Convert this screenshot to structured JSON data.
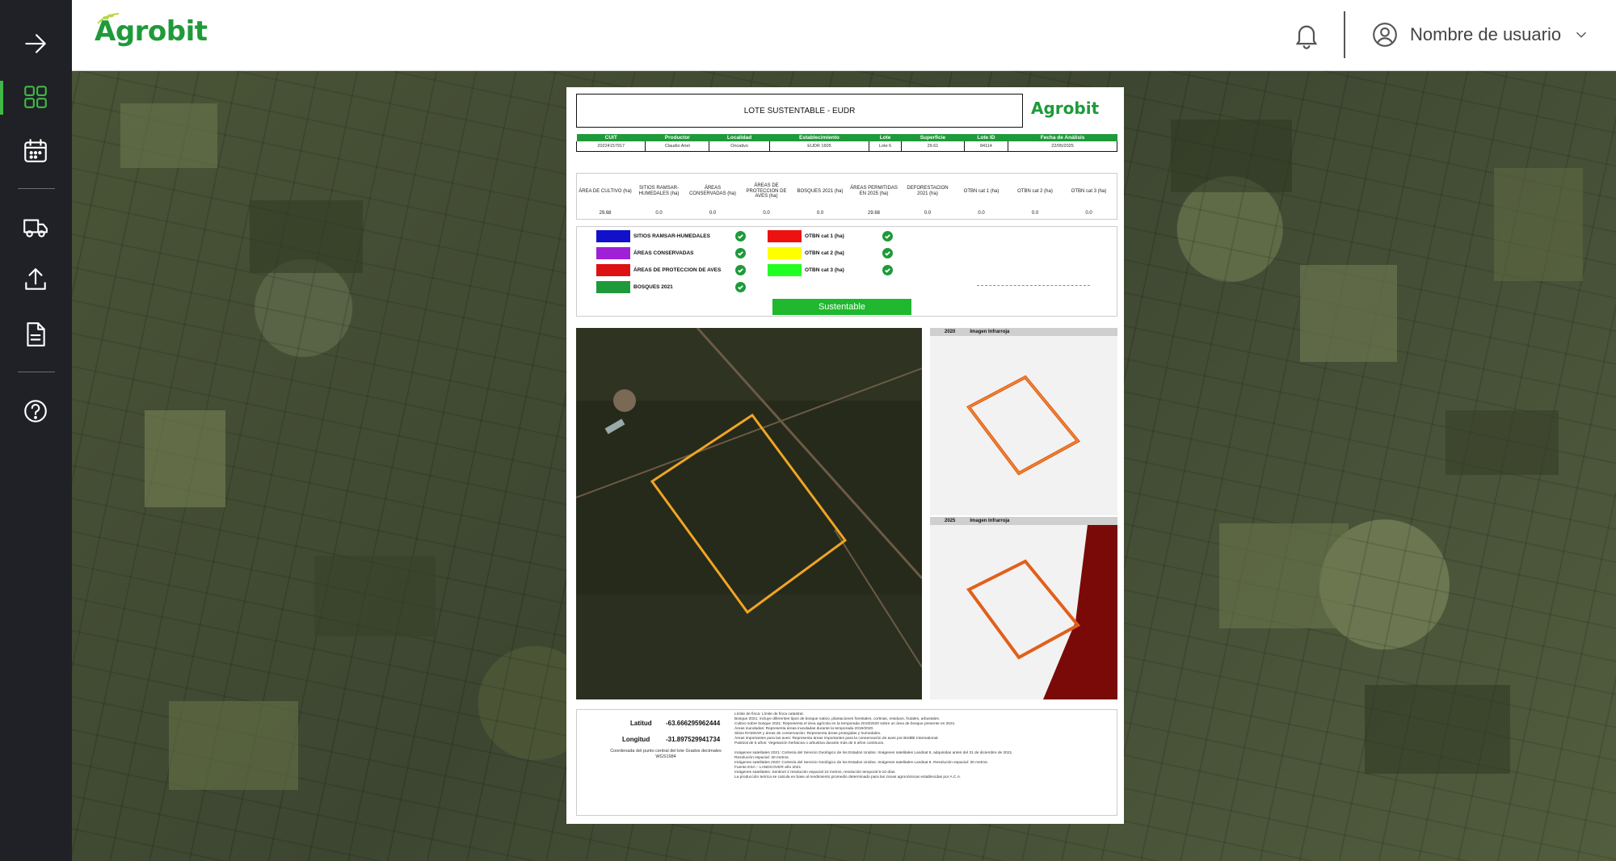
{
  "app": {
    "logo": "Agrobit",
    "user_name": "Nombre de usuario"
  },
  "colors": {
    "brand_green": "#1f9a3a",
    "sidebar_bg": "#1f2126",
    "active": "#41b847"
  },
  "sidebar": {
    "items": [
      {
        "icon": "arrow-right-icon"
      },
      {
        "icon": "dashboard-icon",
        "active": true
      },
      {
        "icon": "calendar-icon"
      },
      {
        "icon": "truck-icon"
      },
      {
        "icon": "upload-icon"
      },
      {
        "icon": "document-icon"
      },
      {
        "icon": "help-icon"
      }
    ]
  },
  "report": {
    "title": "LOTE SUSTENTABLE - EUDR",
    "logo": "Agrobit",
    "info_headers": [
      "CUIT",
      "Productor",
      "Localidad",
      "Establecimiento",
      "Lote",
      "Superficie",
      "Lote ID",
      "Fecha de Análisis"
    ],
    "info_values": [
      "20224157917",
      "Claudio Ariel",
      "Oncativo",
      "EUDR 1605",
      "Lote 6",
      "29.61",
      "84114",
      "22/05/2025"
    ],
    "metrics": [
      {
        "label": "ÁREA DE CULTIVO (ha)",
        "value": "29.68"
      },
      {
        "label": "SITIOS RAMSAR-HUMEDALES (ha)",
        "value": "0.0"
      },
      {
        "label": "ÁREAS CONSERVADAS (ha)",
        "value": "0.0"
      },
      {
        "label": "ÁREAS DE PROTECCION DE AVES (ha)",
        "value": "0.0"
      },
      {
        "label": "BOSQUES 2021 (ha)",
        "value": "0.0"
      },
      {
        "label": "ÁREAS PERMITIDAS EN 2025 (ha)",
        "value": "29.68"
      },
      {
        "label": "DEFORESTACION 2021 (ha)",
        "value": "0.0"
      },
      {
        "label": "OTBN cat 1 (ha)",
        "value": "0.0"
      },
      {
        "label": "OTBN cat 2 (ha)",
        "value": "0.0"
      },
      {
        "label": "OTBN cat 3 (ha)",
        "value": "0.0"
      }
    ],
    "legend_left": [
      {
        "label": "SITIOS RAMSAR-HUMEDALES",
        "color": "#1111cc"
      },
      {
        "label": "ÁREAS CONSERVADAS",
        "color": "#a020d8"
      },
      {
        "label": "ÁREAS DE PROTECCION DE AVES",
        "color": "#dd1111"
      },
      {
        "label": "BOSQUES 2021",
        "color": "#1f9a3a"
      }
    ],
    "legend_right": [
      {
        "label": "OTBN cat 1 (ha)",
        "color": "#ee1111"
      },
      {
        "label": "OTBN cat 2 (ha)",
        "color": "#ffff00"
      },
      {
        "label": "OTBN cat 3 (ha)",
        "color": "#22ff22"
      }
    ],
    "status_label": "Sustentable",
    "ir_2020": {
      "year": "2020",
      "label": "Imagen Infrarroja"
    },
    "ir_2025": {
      "year": "2025",
      "label": "Imagen Infrarroja"
    },
    "lat_label": "Latitud",
    "lat_value": "-63.666295962444",
    "lon_label": "Longitud",
    "lon_value": "-31.897529941734",
    "coord_note": "Coordenada del punto central del lote Grados decimales WGS1984",
    "notes": [
      "Límite de finca: Límite de finca catastral.",
      "Bosque 2021: incluye diferentes tipos de bosque nativo, plantaciones forestales, cortinas, residuos, frutales, arbustales.",
      "Cultivo sobre bosque 2021: Representa el área agrícola en la temporada 2019/2020 sobre un área de bosque presente en 2021.",
      "Áreas inundadas: Representa áreas inundadas durante la temporada 2019/2020.",
      "Sitios RAMSAR y áreas de conservación: Representa áreas protegidas y humedales.",
      "Áreas importantes para las aves: Representa áreas importantes para la conservación de aves por BirdBlr International.",
      "Pastizal de 5 años: Vegetación herbácea o arbustiva durante más de 5 años continuos.",
      "",
      "Imágenes satelitales 2021: Cortesía del Servicio Geológico de los Estados Unidos. Imágenes satelitales Landsat 5, adquiridas antes del 31 de diciembre de 2021.",
      "Resolución espacial: 30 metros.",
      "Imágenes satelitales 2020: Cortesía del Servicio Geológico de los Estados Unidos. Imágenes satelitales Landsat 8. Resolución espacial: 30 metros.",
      "Fuente ESA – LANDCOVER año 2021",
      "Imágenes satelitales: Sentinel 2 resolución espacial 10 metros, resolución temporal 5-10 días.",
      "La producción teórica se calcula en base al rendimiento promedio determinado para las zonas agronómicas establecidas por A.C.A."
    ]
  }
}
